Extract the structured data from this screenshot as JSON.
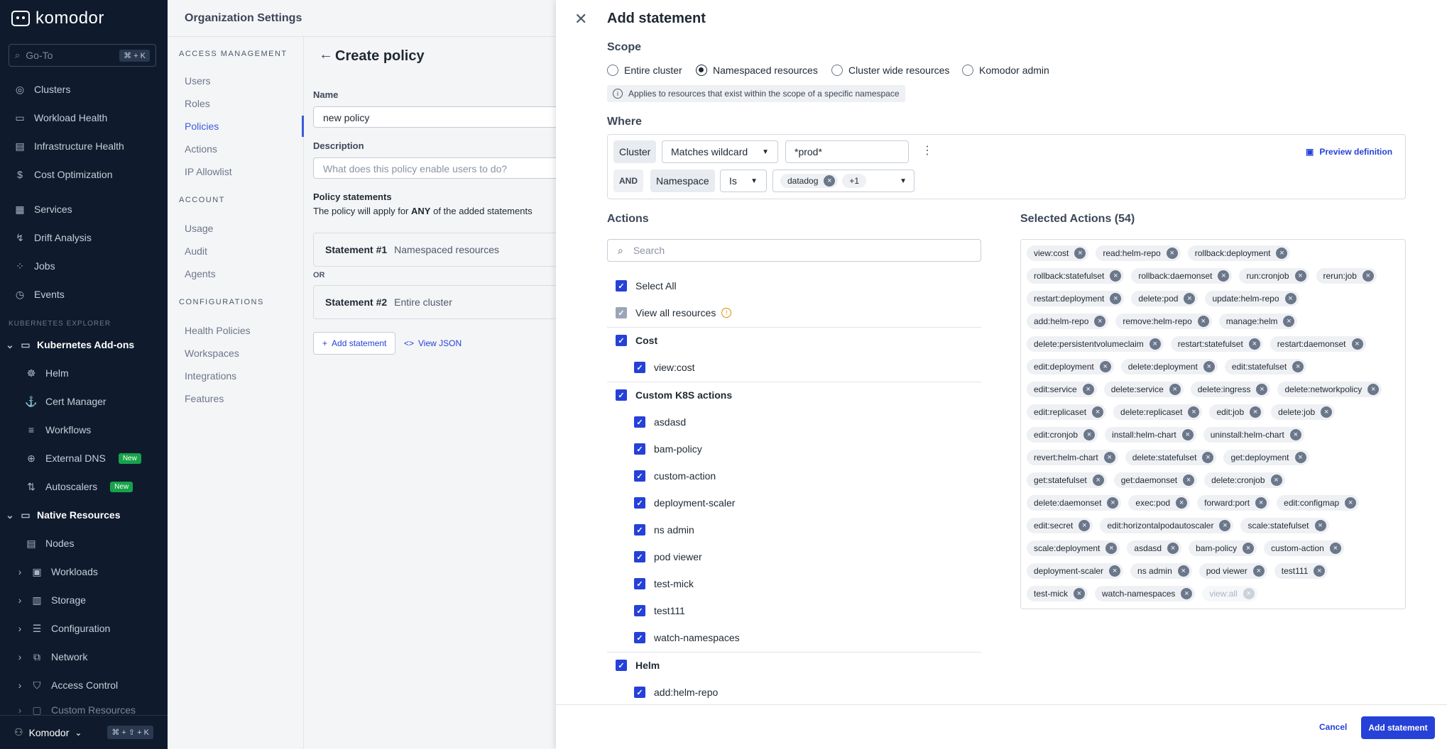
{
  "sidebar": {
    "logo": "komodor",
    "goto_placeholder": "Go-To",
    "goto_shortcut": "⌘ + K",
    "items": [
      {
        "label": "Clusters"
      },
      {
        "label": "Workload Health"
      },
      {
        "label": "Infrastructure Health"
      },
      {
        "label": "Cost Optimization"
      },
      {
        "label": "Services"
      },
      {
        "label": "Drift Analysis"
      },
      {
        "label": "Jobs"
      },
      {
        "label": "Events"
      }
    ],
    "explorer_caption": "KUBERNETES EXPLORER",
    "addons_label": "Kubernetes Add-ons",
    "addons": [
      {
        "label": "Helm"
      },
      {
        "label": "Cert Manager"
      },
      {
        "label": "Workflows"
      },
      {
        "label": "External DNS",
        "badge": "New"
      },
      {
        "label": "Autoscalers",
        "badge": "New"
      }
    ],
    "native_label": "Native Resources",
    "native": [
      {
        "label": "Nodes"
      },
      {
        "label": "Workloads"
      },
      {
        "label": "Storage"
      },
      {
        "label": "Configuration"
      },
      {
        "label": "Network"
      },
      {
        "label": "Access Control"
      },
      {
        "label": "Custom Resources"
      }
    ],
    "account_label": "Komodor",
    "bottom_shortcut": "⌘ + ⇧ + K"
  },
  "org": {
    "title": "Organization Settings",
    "access_caption": "ACCESS MANAGEMENT",
    "access_items": [
      "Users",
      "Roles",
      "Policies",
      "Actions",
      "IP Allowlist"
    ],
    "account_caption": "ACCOUNT",
    "account_items": [
      "Usage",
      "Audit",
      "Agents"
    ],
    "config_caption": "CONFIGURATIONS",
    "config_items": [
      "Health Policies",
      "Workspaces",
      "Integrations",
      "Features"
    ]
  },
  "policy": {
    "title": "Create policy",
    "name_label": "Name",
    "name_value": "new policy",
    "desc_label": "Description",
    "desc_placeholder": "What does this policy enable users to do?",
    "statements_label": "Policy statements",
    "statements_hint_pre": "The policy will apply for",
    "statements_hint_bold": "ANY",
    "statements_hint_post": "of the added statements",
    "stmt1_num": "Statement #1",
    "stmt1_scope": "Namespaced resources",
    "or_label": "OR",
    "stmt2_num": "Statement #2",
    "stmt2_scope": "Entire cluster",
    "add_statement": "Add statement",
    "view_json": "View JSON"
  },
  "modal": {
    "title": "Add statement",
    "scope_label": "Scope",
    "scope_options": [
      "Entire cluster",
      "Namespaced resources",
      "Cluster wide resources",
      "Komodor admin"
    ],
    "scope_selected": "Namespaced resources",
    "scope_info": "Applies to resources that exist within the scope of a specific namespace",
    "where_label": "Where",
    "cluster_label": "Cluster",
    "cluster_op": "Matches wildcard",
    "cluster_value": "*prod*",
    "preview": "Preview definition",
    "and_label": "AND",
    "ns_label": "Namespace",
    "ns_op": "Is",
    "ns_chip": "datadog",
    "ns_more": "+1",
    "actions_label": "Actions",
    "search_placeholder": "Search",
    "select_all": "Select All",
    "view_all": "View all resources",
    "groups": {
      "cost": "Cost",
      "cost_items": [
        "view:cost"
      ],
      "custom": "Custom K8S actions",
      "custom_items": [
        "asdasd",
        "bam-policy",
        "custom-action",
        "deployment-scaler",
        "ns admin",
        "pod viewer",
        "test-mick",
        "test111",
        "watch-namespaces"
      ],
      "helm": "Helm",
      "helm_items": [
        "add:helm-repo"
      ]
    },
    "selected_title": "Selected Actions (54)",
    "selected": [
      [
        "view:cost",
        "read:helm-repo",
        "rollback:deployment"
      ],
      [
        "rollback:statefulset",
        "rollback:daemonset",
        "run:cronjob",
        "rerun:job"
      ],
      [
        "restart:deployment",
        "delete:pod",
        "update:helm-repo"
      ],
      [
        "add:helm-repo",
        "remove:helm-repo",
        "manage:helm"
      ],
      [
        "delete:persistentvolumeclaim",
        "restart:statefulset",
        "restart:daemonset"
      ],
      [
        "edit:deployment",
        "delete:deployment",
        "edit:statefulset"
      ],
      [
        "edit:service",
        "delete:service",
        "delete:ingress",
        "delete:networkpolicy"
      ],
      [
        "edit:replicaset",
        "delete:replicaset",
        "edit:job",
        "delete:job"
      ],
      [
        "edit:cronjob",
        "install:helm-chart",
        "uninstall:helm-chart"
      ],
      [
        "revert:helm-chart",
        "delete:statefulset",
        "get:deployment"
      ],
      [
        "get:statefulset",
        "get:daemonset",
        "delete:cronjob"
      ],
      [
        "delete:daemonset",
        "exec:pod",
        "forward:port",
        "edit:configmap"
      ],
      [
        "edit:secret",
        "edit:horizontalpodautoscaler",
        "scale:statefulset"
      ],
      [
        "scale:deployment",
        "asdasd",
        "bam-policy",
        "custom-action"
      ],
      [
        "deployment-scaler",
        "ns admin",
        "pod viewer",
        "test111"
      ],
      [
        "test-mick",
        "watch-namespaces",
        "view:all"
      ]
    ],
    "cancel": "Cancel",
    "submit": "Add statement"
  },
  "colors": {
    "brand": "#2541d8",
    "sidebar_bg": "#0f1b2d",
    "new_badge": "#17a34a"
  }
}
